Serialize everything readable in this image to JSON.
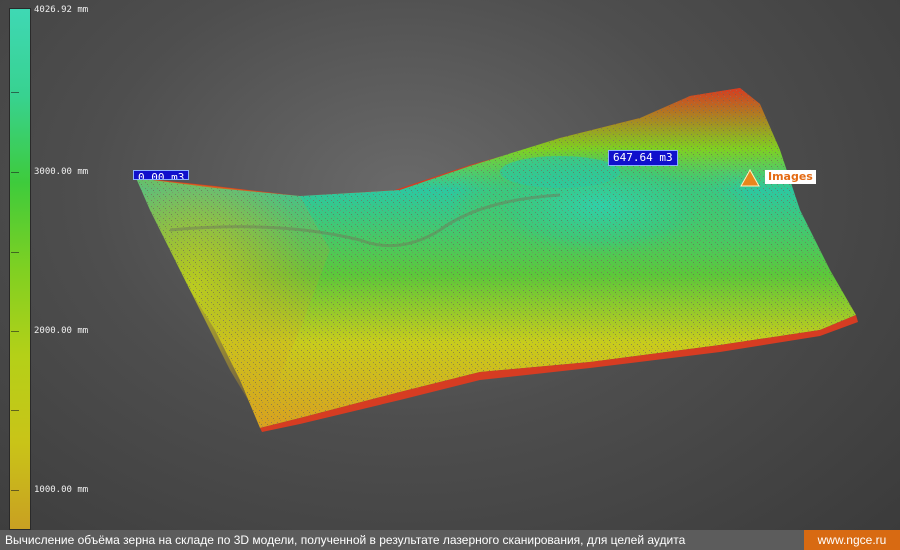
{
  "colorbar": {
    "gradient_colors": [
      "#3fd8b4",
      "#38d290",
      "#3ecb3c",
      "#7fd022",
      "#b4d018",
      "#c9c418",
      "#c9a022"
    ],
    "labels": [
      "4026.92 mm",
      "3000.00 mm",
      "2000.00 mm",
      "1000.00 mm"
    ]
  },
  "volume_tags": [
    {
      "text": "647.64 m3"
    },
    {
      "text": "0.00 m3"
    }
  ],
  "images_marker": {
    "label": "Images",
    "icon": "warning-triangle-icon",
    "color": "#e8861c"
  },
  "surface_colors": {
    "low": "#d63c22",
    "mid_low": "#d8a020",
    "mid": "#c8cc1c",
    "mid_high": "#4cc83a",
    "high": "#2cc8a0"
  },
  "footer": {
    "caption": "Вычисление объёма зерна на складе по 3D модели, полученной в результате лазерного сканирования, для целей аудита",
    "site": "www.ngce.ru"
  }
}
